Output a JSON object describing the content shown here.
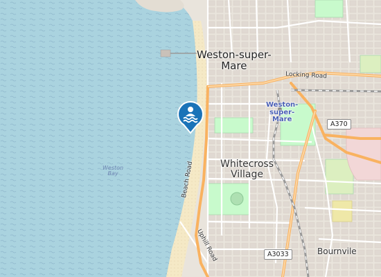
{
  "map": {
    "places": {
      "town": "Weston-super-\nMare",
      "village": "Whitecross\nVillage",
      "station": "Weston-\nsuper-\nMare",
      "bourneville": "Bournvile"
    },
    "water": {
      "bay": "Weston\nBay"
    },
    "roads": {
      "locking": "Locking Road",
      "beach": "Beach Road",
      "uphill": "Uphill Road"
    },
    "shields": {
      "a370": "A370",
      "a3033": "A3033"
    },
    "marker": {
      "icon": "swimming-icon",
      "color": "#1a73b8"
    },
    "colors": {
      "sea": "#aad3df",
      "sand": "#f5e9c6",
      "land": "#e9e4dc",
      "park": "#c8facc",
      "major_road": "#f9b260",
      "railway": "#999999"
    }
  }
}
